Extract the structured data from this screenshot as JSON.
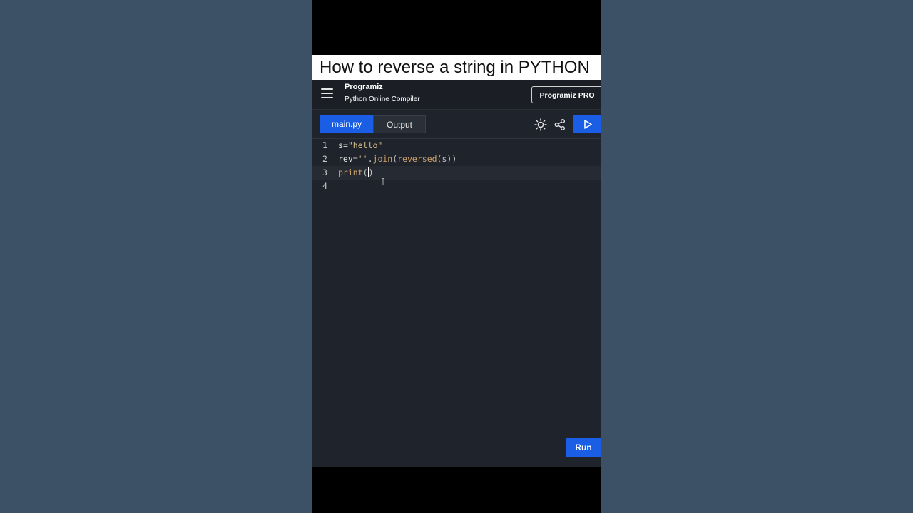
{
  "video": {
    "caption": "How to reverse a string in PYTHON"
  },
  "header": {
    "brand": "Programiz",
    "subtitle": "Python Online Compiler",
    "pro_button": "Programiz PRO"
  },
  "toolbar": {
    "tab_main": "main.py",
    "tab_output": "Output",
    "icons": [
      "sun-icon",
      "share-icon",
      "play-icon"
    ]
  },
  "editor": {
    "lines": [
      {
        "number": "1",
        "code": "s=\"hello\""
      },
      {
        "number": "2",
        "code": "rev=''.join(reversed(s))"
      },
      {
        "number": "3",
        "code": "print()"
      },
      {
        "number": "4",
        "code": ""
      }
    ],
    "active_line": 3
  },
  "run_button": "Run",
  "colors": {
    "accent": "#1a5ee6",
    "editor_bg": "#1f242c",
    "string": "#d6b98c"
  }
}
